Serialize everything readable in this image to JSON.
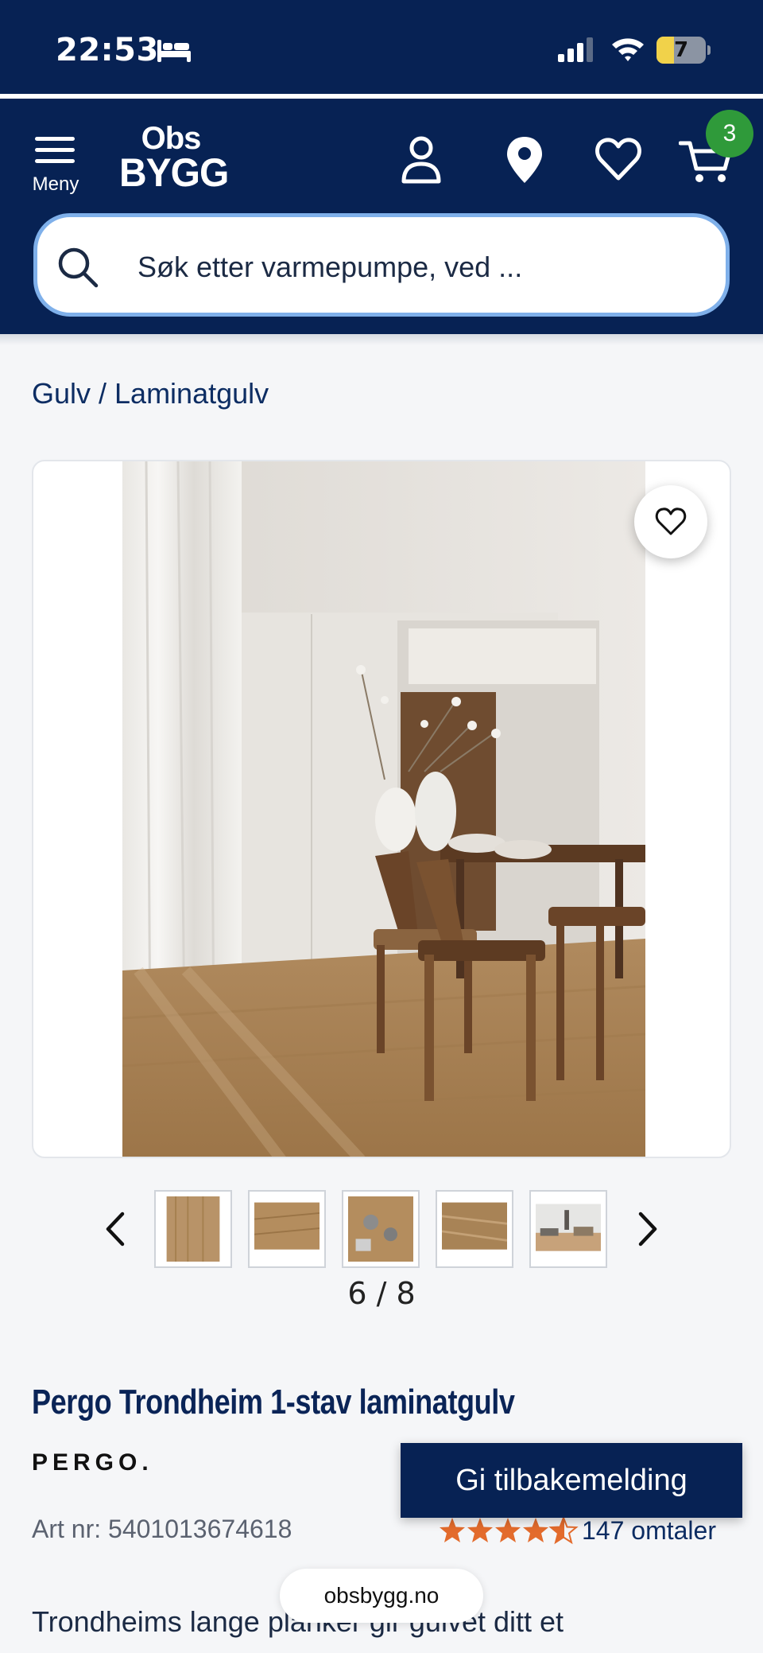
{
  "status_bar": {
    "time": "22:53",
    "battery": "7"
  },
  "header": {
    "menu_label": "Meny",
    "logo_line1": "Obs",
    "logo_line2": "BYGG",
    "cart_count": "3"
  },
  "search": {
    "placeholder": "Søk etter varmepumpe, ved ..."
  },
  "breadcrumb": "Gulv / Laminatgulv",
  "gallery": {
    "counter": "6 / 8",
    "thumbnail_count": 5
  },
  "product": {
    "title": "Pergo Trondheim 1-stav laminatgulv",
    "brand": "PERGO.",
    "art_nr": "Art nr: 5401013674618",
    "rating_value": 4.5,
    "rating_max": 5,
    "review_count": "147 omtaler",
    "description": "Trondheims lange planker gir gulvet ditt et"
  },
  "feedback_button": "Gi tilbakemelding",
  "browser_url": "obsbygg.no",
  "colors": {
    "brand_navy": "#072254",
    "badge_green": "#2f9a3a",
    "star_orange": "#e36b2c",
    "search_border": "#7fb0ea"
  }
}
